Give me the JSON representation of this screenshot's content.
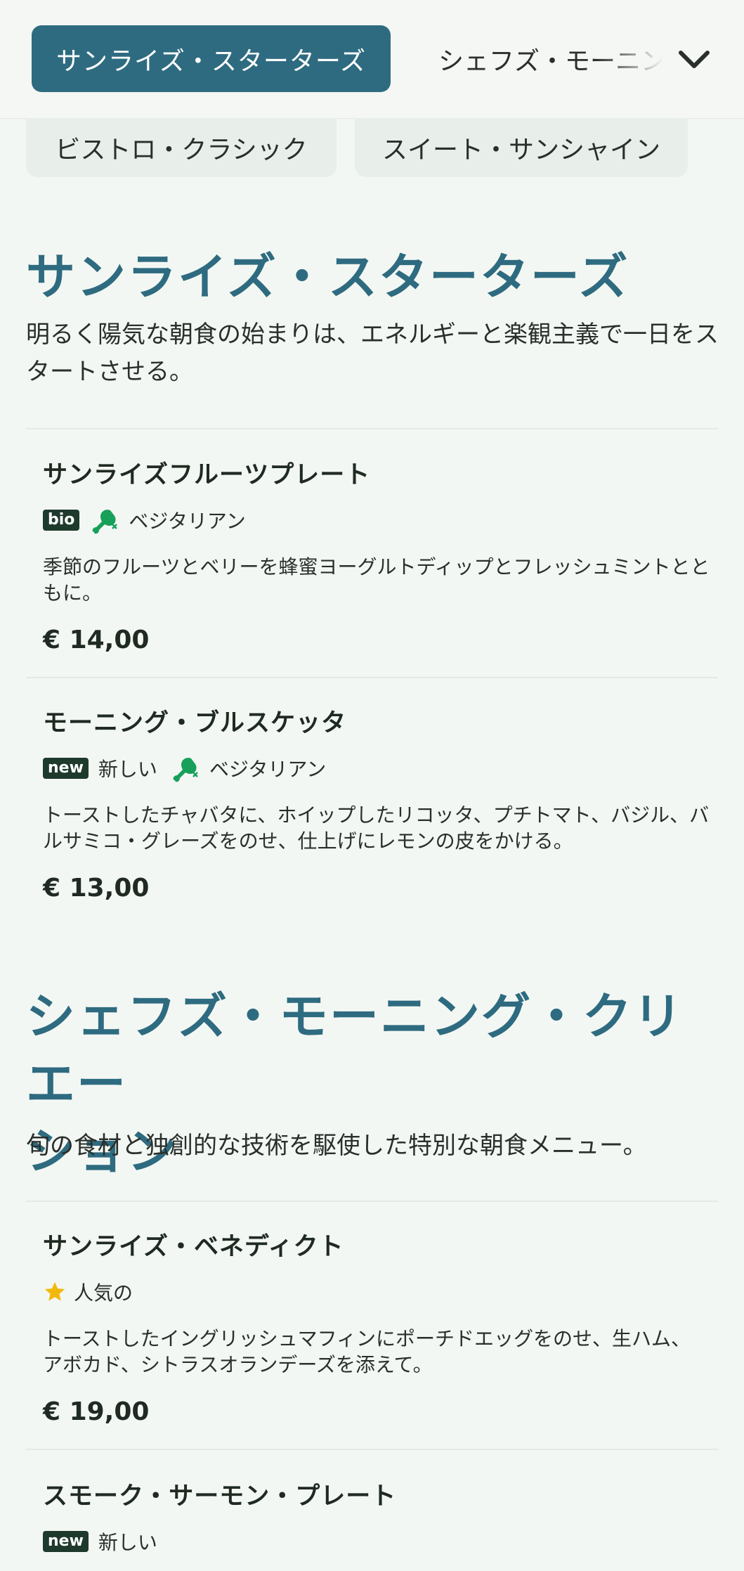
{
  "nav": {
    "active_tab": "サンライズ・スターターズ",
    "next_tab": "シェフズ・モーニング・クリエーション",
    "row2_tabs": [
      "ビストロ・クラシック",
      "スイート・サンシャイン"
    ]
  },
  "sections": [
    {
      "title": "サンライズ・スターターズ",
      "description": "明るく陽気な朝食の始まりは、エネルギーと楽観主義で一日をスタートさせる。",
      "items": [
        {
          "name": "サンライズフルーツプレート",
          "badge": "bio",
          "tag": "ベジタリアン",
          "description": "季節のフルーツとベリーを蜂蜜ヨーグルトディップとフレッシュミントとともに。",
          "price": "€ 14,00"
        },
        {
          "name": "モーニング・ブルスケッタ",
          "badge": "new",
          "badge_label": "新しい",
          "tag": "ベジタリアン",
          "description": "トーストしたチャバタに、ホイップしたリコッタ、プチトマト、バジル、バルサミコ・グレーズをのせ、仕上げにレモンの皮をかける。",
          "price": "€ 13,00"
        }
      ]
    },
    {
      "title_line1": "シェフズ・モーニング・クリエー",
      "title_line2": "ション",
      "description": "旬の食材と独創的な技術を駆使した特別な朝食メニュー。",
      "items": [
        {
          "name": "サンライズ・ベネディクト",
          "tag": "人気の",
          "description": "トーストしたイングリッシュマフィンにポーチドエッグをのせ、生ハム、アボカド、シトラスオランデーズを添えて。",
          "price": "€ 19,00"
        },
        {
          "name": "スモーク・サーモン・プレート",
          "badge": "new",
          "badge_label": "新しい"
        }
      ]
    }
  ],
  "colors": {
    "accent": "#2e6b80",
    "badge_bg": "#1e3a2c",
    "veg_green": "#17a05a",
    "star": "#f2b90c",
    "background": "#f3f7f3"
  },
  "icons": {
    "veg": "drumstick-crossed-icon",
    "popular": "star-icon",
    "expand": "chevron-down-icon"
  }
}
